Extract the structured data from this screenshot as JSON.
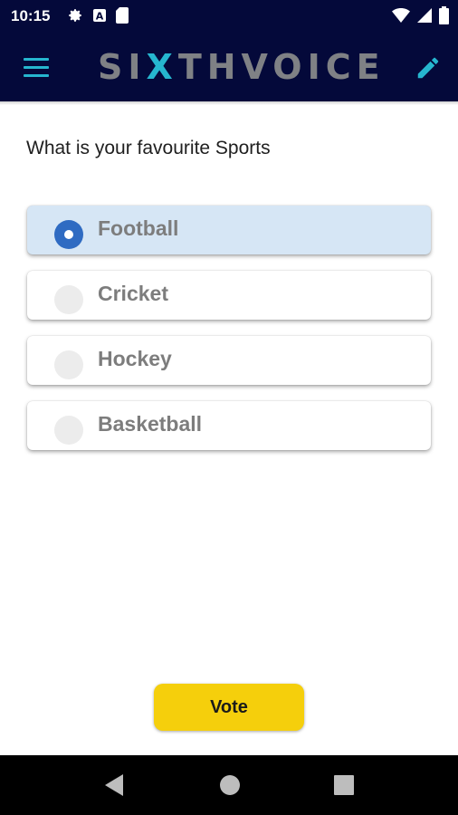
{
  "status_bar": {
    "time": "10:15",
    "left_icons": [
      "gear-icon",
      "a-icon",
      "sd-card-icon"
    ],
    "right_icons": [
      "wifi-icon",
      "signal-icon",
      "battery-icon"
    ]
  },
  "app_bar": {
    "logo_prefix": "SI",
    "logo_x": "X",
    "logo_suffix": "THVOICE",
    "menu_icon": "hamburger-menu-icon",
    "edit_icon": "pencil-edit-icon",
    "colors": {
      "background": "#04093a",
      "accent": "#26b6cf",
      "logo_text": "#7f8185"
    }
  },
  "poll": {
    "question": "What is your favourite Sports",
    "options": [
      {
        "label": "Football",
        "selected": true
      },
      {
        "label": "Cricket",
        "selected": false
      },
      {
        "label": "Hockey",
        "selected": false
      },
      {
        "label": "Basketball",
        "selected": false
      }
    ],
    "selected_color": "#d6e6f5",
    "radio_color": "#2f6bc2"
  },
  "vote_button": {
    "label": "Vote",
    "color": "#f5cf0c"
  },
  "nav_bar": {
    "buttons": [
      "back-icon",
      "home-icon",
      "recents-icon"
    ]
  }
}
